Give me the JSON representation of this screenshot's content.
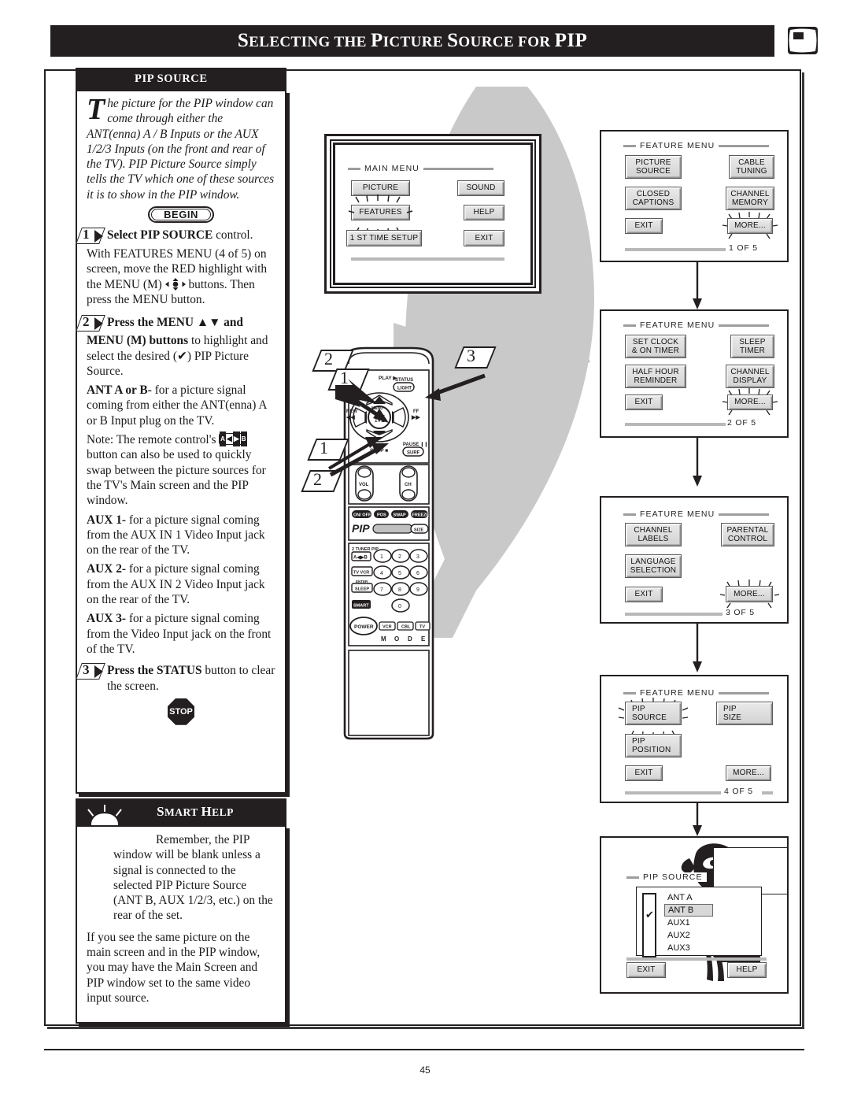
{
  "header": {
    "title_main": "SELECTING THE PICTURE SOURCE FOR PIP",
    "title_parts": [
      "S",
      "ELECTING THE ",
      "P",
      "ICTURE ",
      "S",
      "OURCE FOR ",
      "PIP"
    ],
    "icon": "pip-tv-icon"
  },
  "page": {
    "number": "45"
  },
  "left_panel": {
    "tab_label": "PIP SOURCE",
    "intro_dropcap": "T",
    "intro_text": "he picture for the PIP window can come through either the ANT(enna) A / B Inputs or the AUX 1/2/3 Inputs (on the front and rear of the TV). PIP Picture Source simply tells the TV which one of these sources it is to show in the PIP window.",
    "begin_label": "BEGIN",
    "steps": [
      {
        "num": "1",
        "bold": "Select PIP SOURCE",
        "rest": " control.",
        "body": "With FEATURES MENU (4 of 5) on screen, move the RED highlight with the MENU (M)",
        "body2": "buttons. Then press the MENU button."
      },
      {
        "num": "2",
        "bold": "Press the MENU ▲▼ and",
        "bold2": "MENU (M) buttons",
        "rest": " to highlight and select the desired (✔) PIP Picture Source."
      },
      {
        "num": "3",
        "bold": "Press the STATUS",
        "rest": " button to clear the screen."
      }
    ],
    "ant_label": "ANT A or B-",
    "ant_text": " for a picture signal coming from either the ANT(enna) A or B Input plug on the TV.",
    "note_pre": "Note: The remote control's",
    "note_post": "button can also be used to quickly swap between the picture sources for the TV's Main screen and the PIP window.",
    "swap_button_icon": "a-b-swap-icon",
    "aux1_label": "AUX 1-",
    "aux1_text": " for a picture signal coming from the AUX IN 1 Video Input jack on the rear of the TV.",
    "aux2_label": "AUX 2-",
    "aux2_text": " for a picture signal coming from the AUX IN 2 Video Input jack on the rear of the TV.",
    "aux3_label": "AUX 3-",
    "aux3_text": " for a picture signal coming from the Video Input jack on the front of the TV.",
    "stop_label": "STOP"
  },
  "smart_help": {
    "title": "SMART HELP",
    "title_parts": [
      "S",
      "MART ",
      "H",
      "ELP"
    ],
    "paragraph1": "Remember, the PIP window will be blank unless a signal is connected to the selected PIP Picture Source (ANT B, AUX 1/2/3, etc.) on the rear of the set.",
    "paragraph2": "If you see the same picture on the main screen and in the PIP window, you may have the Main Screen and PIP window set to the same video input source."
  },
  "main_menu": {
    "title": "MAIN MENU",
    "buttons_left": [
      "PICTURE",
      "FEATURES",
      "1 ST TIME SETUP"
    ],
    "buttons_right": [
      "SOUND",
      "HELP",
      "EXIT"
    ],
    "highlighted": "FEATURES"
  },
  "feature_menus": [
    {
      "title": "FEATURE MENU",
      "page_count": "1 OF 5",
      "buttons_left": [
        "PICTURE\nSOURCE",
        "CLOSED\nCAPTIONS",
        "EXIT"
      ],
      "buttons_right": [
        "CABLE\nTUNING",
        "CHANNEL\nMEMORY",
        "MORE..."
      ],
      "highlighted": "MORE..."
    },
    {
      "title": "FEATURE MENU",
      "page_count": "2 OF 5",
      "buttons_left": [
        "SET CLOCK\n& ON TIMER",
        "HALF HOUR\nREMINDER",
        "EXIT"
      ],
      "buttons_right": [
        "SLEEP\nTIMER",
        "CHANNEL\nDISPLAY",
        "MORE..."
      ],
      "highlighted": "MORE..."
    },
    {
      "title": "FEATURE MENU",
      "page_count": "3 OF 5",
      "buttons_left": [
        "CHANNEL\nLABELS",
        "LANGUAGE\nSELECTION",
        "EXIT"
      ],
      "buttons_right": [
        "PARENTAL\nCONTROL",
        "",
        "MORE..."
      ],
      "highlighted": "MORE..."
    },
    {
      "title": "FEATURE MENU",
      "page_count": "4 OF 5",
      "buttons_left": [
        "PIP\nSOURCE",
        "PIP\nPOSITION",
        "EXIT"
      ],
      "buttons_right": [
        "PIP\nSIZE",
        "",
        "MORE..."
      ],
      "highlighted": "PIP SOURCE"
    }
  ],
  "pip_source_screen": {
    "title": "PIP SOURCE",
    "options": [
      "ANT A",
      "ANT B",
      "AUX1",
      "AUX2",
      "AUX3"
    ],
    "selected": "ANT B",
    "check_mark": "✔",
    "exit_label": "EXIT",
    "help_label": "HELP"
  },
  "remote": {
    "labels": {
      "play": "PLAY ▶",
      "rew": "REW\n◀◀",
      "ff": "FF\n▶▶",
      "stop": "STOP ■",
      "pause": "PAUSE ❙❙",
      "menu": "MENU",
      "menu_center": "M",
      "status": "STATUS",
      "light": "LIGHT",
      "surf": "SURF",
      "vol": "VOL",
      "ch": "CH",
      "pip_row": [
        "ON/ OFF",
        "POS",
        "SWAP",
        "FREEZE"
      ],
      "pip_logo": "PIP",
      "size": "SIZE",
      "tuner_pip": "2 TUNER PIP",
      "tv_vcr": "TV  VCR",
      "enter": "ENTER",
      "sleep": "SLEEP",
      "smart": "SMART",
      "power": "POWER",
      "mode_buttons": [
        "VCR",
        "CBL",
        "TV"
      ],
      "mode_letters": [
        "M",
        "O",
        "D",
        "E"
      ],
      "digits": [
        "1",
        "2",
        "3",
        "4",
        "5",
        "6",
        "7",
        "8",
        "9",
        "0"
      ]
    }
  },
  "callouts": [
    {
      "num": "2",
      "pos": "upper-left"
    },
    {
      "num": "1",
      "pos": "upper-left-inner"
    },
    {
      "num": "3",
      "pos": "upper-right"
    },
    {
      "num": "1",
      "pos": "lower-left-inner"
    },
    {
      "num": "2",
      "pos": "lower-left"
    }
  ],
  "colors": {
    "ink": "#231f20",
    "gray_blob": "#c9c9c9",
    "osd_button": "#d2d2d2",
    "paper": "#ffffff"
  }
}
